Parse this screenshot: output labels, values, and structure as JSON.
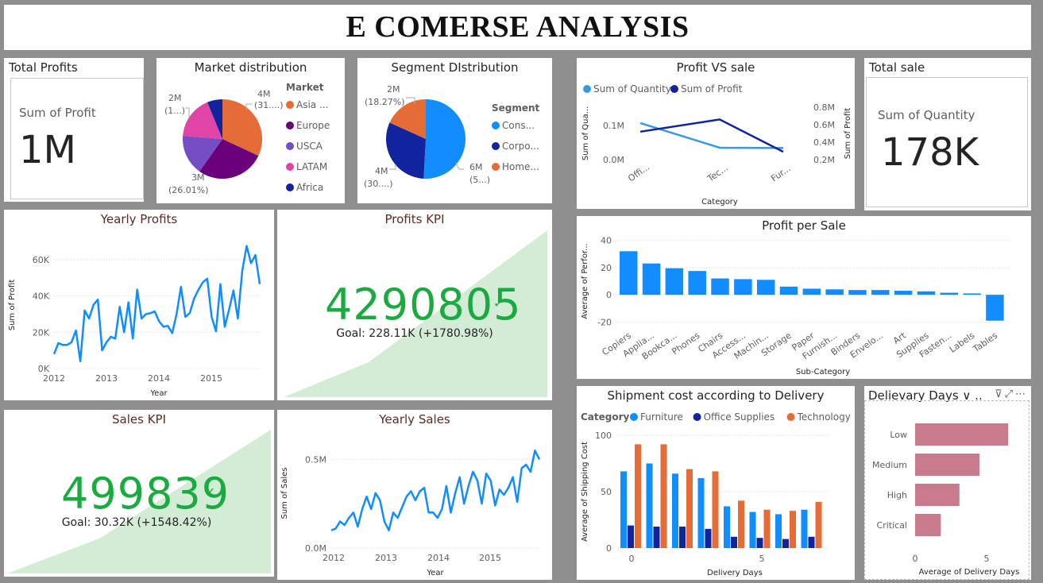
{
  "page_title": "E COMERSE ANALYSIS",
  "total_profits": {
    "title": "Total Profits",
    "label": "Sum of Profit",
    "value": "1M"
  },
  "total_sale": {
    "title": "Total sale",
    "label": "Sum of Quantity",
    "value": "178K"
  },
  "colors": {
    "blue": "#118dff",
    "navy": "#12239e",
    "orange": "#e66c37",
    "purple": "#6b007b",
    "violet": "#744ec2",
    "pink": "#d64550",
    "magenta": "#e044a7",
    "green": "#1aab40",
    "rose": "#c97b8e",
    "lightblue": "#3599e6"
  },
  "chart_data": [
    {
      "id": "market",
      "type": "pie",
      "title": "Market distribution",
      "legend_title": "Market",
      "legend_position": "right",
      "categories": [
        "Asia ...",
        "Europe",
        "USCA",
        "LATAM",
        "Africa"
      ],
      "values": [
        31,
        27,
        16,
        17,
        6
      ],
      "colors": [
        "#e66c37",
        "#6b007b",
        "#744ec2",
        "#e044a7",
        "#12239e"
      ],
      "data_labels": [
        "4M",
        "(31....)",
        "3M",
        "(26.01%)",
        "2M",
        "(1...)"
      ]
    },
    {
      "id": "segment",
      "type": "pie",
      "title": "Segment DIstribution",
      "legend_title": "Segment",
      "legend_position": "right",
      "categories": [
        "Cons...",
        "Corpo...",
        "Home..."
      ],
      "values": [
        51,
        31,
        18.27
      ],
      "colors": [
        "#118dff",
        "#12239e",
        "#e66c37"
      ],
      "data_labels": [
        "2M",
        "(18.27%)",
        "4M",
        "(30....)",
        "6M",
        "(5...)"
      ]
    },
    {
      "id": "profit-vs-sale",
      "type": "line",
      "title": "Profit VS sale",
      "xlabel": "Category",
      "ylabel_left": "Sum of Qua...",
      "ylabel_right": "Sum of Profit",
      "categories": [
        "Offi...",
        "Tec...",
        "Fur..."
      ],
      "left_ticks": [
        "0.1M",
        "0.0M"
      ],
      "right_ticks": [
        "0.8M",
        "0.6M",
        "0.4M",
        "0.2M"
      ],
      "series": [
        {
          "name": "Sum of Quantity",
          "axis": "left",
          "values": [
            0.107,
            0.035,
            0.034
          ]
        },
        {
          "name": "Sum of Profit",
          "axis": "right",
          "values": [
            0.52,
            0.66,
            0.29
          ]
        }
      ]
    },
    {
      "id": "yearly-profits",
      "type": "line",
      "title": "Yearly Profits",
      "xlabel": "Year",
      "ylabel": "Sum of Profit",
      "x_ticks": [
        "2012",
        "2013",
        "2014",
        "2015"
      ],
      "y_ticks": [
        "60K",
        "40K",
        "20K",
        "0K"
      ],
      "ylim": [
        0,
        70000
      ],
      "values": [
        8000,
        14000,
        13000,
        13000,
        14500,
        21000,
        4000,
        32000,
        27500,
        35000,
        38000,
        10000,
        14500,
        17500,
        16500,
        34000,
        20000,
        36500,
        16500,
        43500,
        27500,
        30000,
        30500,
        31500,
        26000,
        23000,
        23500,
        19500,
        30000,
        45000,
        28500,
        30500,
        38500,
        43500,
        47500,
        49500,
        28500,
        20500,
        46500,
        23000,
        32500,
        43000,
        27500,
        54000,
        67500,
        58000,
        62500,
        46500
      ]
    },
    {
      "id": "profits-kpi",
      "type": "area",
      "title": "Profits KPI",
      "value": "4290805",
      "goal_text": "Goal: 228.11K (+1780.98%)"
    },
    {
      "id": "profit-per-sale",
      "type": "bar",
      "title": "Profit per Sale",
      "xlabel": "Sub-Category",
      "ylabel": "Average of Perfor...",
      "y_ticks": [
        "40",
        "20",
        "0",
        "-20"
      ],
      "ylim": [
        -25,
        45
      ],
      "categories": [
        "Copiers",
        "Applia...",
        "Bookca...",
        "Phones",
        "Chairs",
        "Access...",
        "Machin...",
        "Storage",
        "Paper",
        "Furnish...",
        "Binders",
        "Envelo...",
        "Art",
        "Supplies",
        "Fasten...",
        "Labels",
        "Tables"
      ],
      "values": [
        32,
        23,
        19.5,
        17.5,
        12,
        11.5,
        11,
        6,
        4.5,
        4,
        3.5,
        3.5,
        3,
        2.5,
        1.5,
        1,
        -19
      ]
    },
    {
      "id": "sales-kpi",
      "type": "area",
      "title": "Sales KPI",
      "value": "499839",
      "goal_text": "Goal: 30.32K (+1548.42%)"
    },
    {
      "id": "yearly-sales",
      "type": "line",
      "title": "Yearly Sales",
      "xlabel": "Year",
      "ylabel": "Sum of Sales",
      "x_ticks": [
        "2012",
        "2013",
        "2014",
        "2015"
      ],
      "y_ticks": [
        "0.5M",
        "0.0M"
      ],
      "ylim": [
        0,
        0.6
      ],
      "values": [
        0.1,
        0.11,
        0.15,
        0.13,
        0.17,
        0.2,
        0.12,
        0.22,
        0.29,
        0.22,
        0.31,
        0.27,
        0.15,
        0.1,
        0.2,
        0.17,
        0.23,
        0.29,
        0.32,
        0.27,
        0.32,
        0.34,
        0.2,
        0.2,
        0.17,
        0.22,
        0.35,
        0.2,
        0.31,
        0.4,
        0.25,
        0.35,
        0.43,
        0.38,
        0.25,
        0.42,
        0.38,
        0.24,
        0.33,
        0.3,
        0.34,
        0.4,
        0.26,
        0.45,
        0.47,
        0.43,
        0.55,
        0.5
      ]
    },
    {
      "id": "shipment-cost",
      "type": "bar",
      "title": "Shipment cost according to Delivery",
      "legend_title": "Category",
      "xlabel": "Delivery Days",
      "ylabel": "Average of Shipping Cost",
      "x_ticks": [
        "0",
        "5"
      ],
      "y_ticks": [
        "100",
        "50",
        "0"
      ],
      "ylim": [
        0,
        100
      ],
      "categories": [
        "0",
        "1",
        "2",
        "3",
        "4",
        "5",
        "6",
        "7"
      ],
      "series": [
        {
          "name": "Furniture",
          "values": [
            68,
            75,
            66,
            62,
            37,
            32,
            30,
            34
          ]
        },
        {
          "name": "Office Supplies",
          "values": [
            20,
            19,
            19,
            17,
            10,
            9,
            8,
            10
          ]
        },
        {
          "name": "Technology",
          "values": [
            92,
            92,
            70,
            68,
            42,
            34,
            33,
            41
          ]
        }
      ]
    },
    {
      "id": "delivery-days",
      "type": "bar",
      "title": "Delievary Days ∨ ...",
      "xlabel": "Average of Delivery Days",
      "x_ticks": [
        "0",
        "5"
      ],
      "xlim": [
        0,
        7
      ],
      "categories": [
        "Low",
        "Medium",
        "High",
        "Critical"
      ],
      "values": [
        6.5,
        4.5,
        3.1,
        1.8
      ]
    }
  ]
}
